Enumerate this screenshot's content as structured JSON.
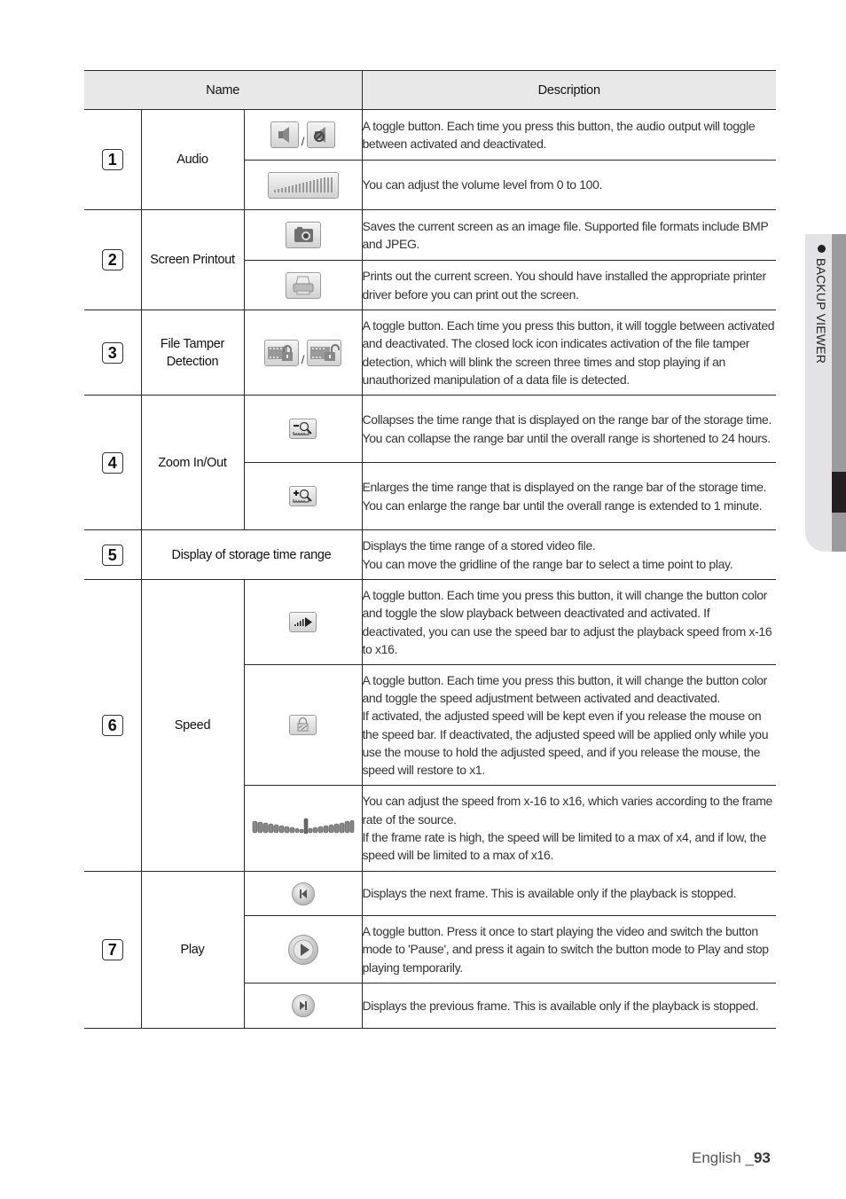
{
  "side_tab": {
    "label": "BACKUP VIEWER"
  },
  "table": {
    "headers": {
      "name": "Name",
      "description": "Description"
    },
    "sections": [
      {
        "number": "1",
        "name": "Audio",
        "rows": [
          {
            "icons": [
              "speaker-on-icon",
              "speaker-mute-icon"
            ],
            "separator": "/",
            "description": "A toggle button. Each time you press this button, the audio output will toggle between activated and deactivated."
          },
          {
            "icons": [
              "volume-bar-icon"
            ],
            "description": "You can adjust the volume level from 0 to 100."
          }
        ]
      },
      {
        "number": "2",
        "name": "Screen Printout",
        "rows": [
          {
            "icons": [
              "camera-icon"
            ],
            "description": "Saves the current screen as an image file. Supported file formats include BMP and JPEG."
          },
          {
            "icons": [
              "printer-icon"
            ],
            "description": "Prints out the current screen. You should have installed the appropriate printer driver before you can print out the screen."
          }
        ]
      },
      {
        "number": "3",
        "name": "File Tamper Detection",
        "rows": [
          {
            "icons": [
              "film-lock-closed-icon",
              "film-lock-open-icon"
            ],
            "separator": "/",
            "description": "A toggle button. Each time you press this button, it will toggle between activated and deactivated. The closed lock icon indicates activation of the file tamper detection, which will blink the screen three times and stop playing if an unauthorized manipulation of a data file is detected."
          }
        ]
      },
      {
        "number": "4",
        "name": "Zoom In/Out",
        "rows": [
          {
            "icons": [
              "zoom-out-icon"
            ],
            "description": "Collapses the time range that is displayed on the range bar of the storage time. You can collapse the range bar until the overall range is shortened to 24 hours."
          },
          {
            "icons": [
              "zoom-in-icon"
            ],
            "description": "Enlarges the time range that is displayed on the range bar of the storage time. You can enlarge the range bar until the overall range is extended to 1 minute."
          }
        ]
      },
      {
        "number": "5",
        "name": "Display of storage time range",
        "rows": [
          {
            "icons": [],
            "description_lines": [
              "Displays the time range of a stored video file.",
              "You can move the gridline of the range bar to select a time point to play."
            ]
          }
        ]
      },
      {
        "number": "6",
        "name": "Speed",
        "rows": [
          {
            "icons": [
              "slow-playback-icon"
            ],
            "description": "A toggle button. Each time you press this button, it will change the button color and toggle the slow playback between deactivated and activated. If deactivated, you can use the speed bar to adjust the playback speed from x-16 to x16."
          },
          {
            "icons": [
              "speed-lock-icon"
            ],
            "description_lines": [
              "A toggle button. Each time you press this button, it will change the button color and toggle the speed adjustment between activated and deactivated.",
              "If activated, the adjusted speed will be kept even if you release the mouse on the speed bar. If deactivated, the adjusted speed will be applied only while you use the mouse to hold the adjusted speed, and if you release the mouse, the speed will restore to x1."
            ]
          },
          {
            "icons": [
              "speed-bar-icon"
            ],
            "description_lines": [
              "You can adjust the speed from x-16 to x16, which varies according to the frame rate of the source.",
              "If the frame rate is high, the speed will be limited to a max of x4, and if low, the speed will be limited to a max of x16."
            ]
          }
        ]
      },
      {
        "number": "7",
        "name": "Play",
        "rows": [
          {
            "icons": [
              "previous-frame-icon"
            ],
            "description": "Displays the next frame. This is available only if the playback is stopped."
          },
          {
            "icons": [
              "play-icon"
            ],
            "description": "A toggle button. Press it once to start playing the video and switch the button mode to 'Pause', and press it again to switch the button mode to Play and stop playing temporarily."
          },
          {
            "icons": [
              "next-frame-icon"
            ],
            "description": "Displays the previous frame. This is available only if the playback is stopped."
          }
        ]
      }
    ]
  },
  "footer": {
    "language": "English _",
    "page": "93"
  }
}
